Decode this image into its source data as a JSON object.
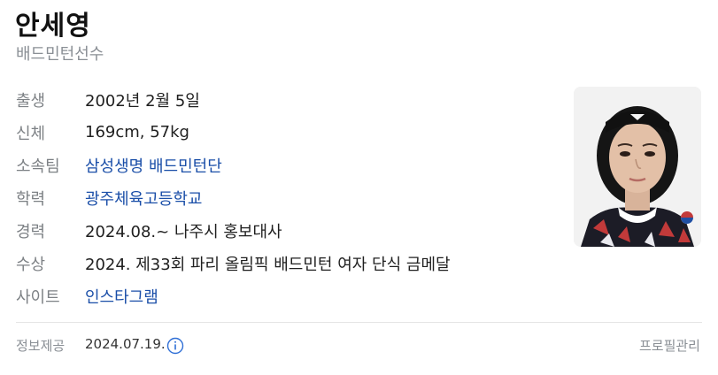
{
  "header": {
    "name": "안세영",
    "occupation": "배드민턴선수"
  },
  "info": [
    {
      "label": "출생",
      "value": "2002년 2월 5일",
      "link": false
    },
    {
      "label": "신체",
      "value": "169cm, 57kg",
      "link": false
    },
    {
      "label": "소속팀",
      "value": "삼성생명 배드민턴단",
      "link": true
    },
    {
      "label": "학력",
      "value": "광주체육고등학교",
      "link": true
    },
    {
      "label": "경력",
      "value": "2024.08.~ 나주시 홍보대사",
      "link": false
    },
    {
      "label": "수상",
      "value": "2024. 제33회 파리 올림픽 배드민턴 여자 단식 금메달",
      "link": false
    },
    {
      "label": "사이트",
      "value": "인스타그램",
      "link": true
    }
  ],
  "footer": {
    "source_label": "정보제공",
    "date": "2024.07.19.",
    "info_icon": "info-circle-icon",
    "profile_manage": "프로필관리"
  },
  "colors": {
    "link": "#1a4ea8",
    "label": "#7d8185",
    "icon": "#2f6fd6"
  }
}
